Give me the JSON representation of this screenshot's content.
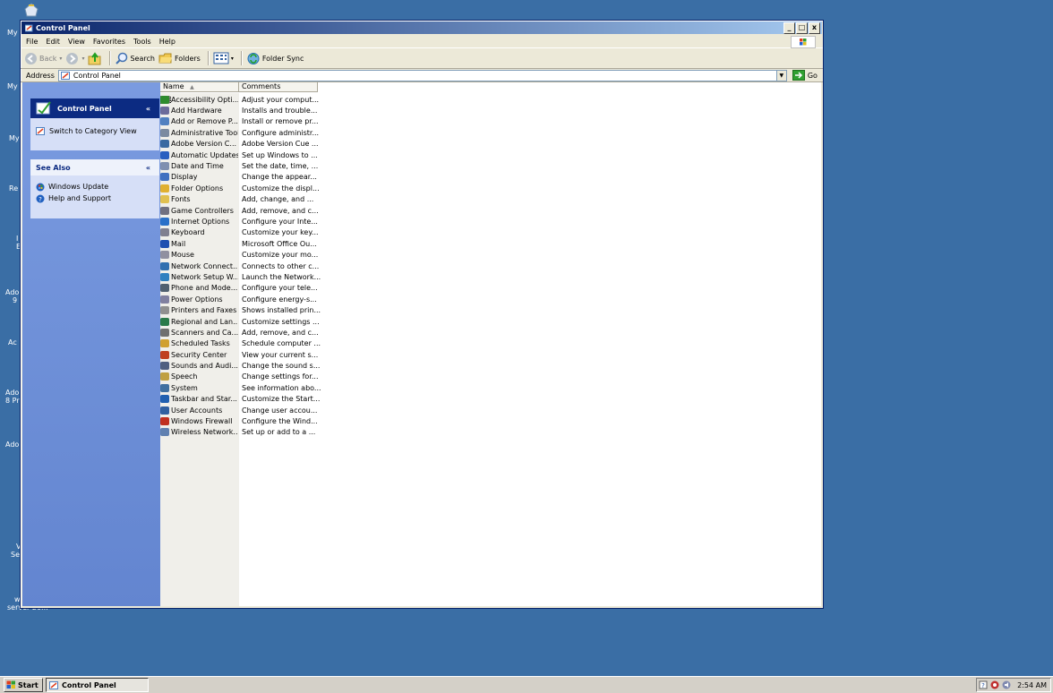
{
  "desktop": {
    "fragments": [
      "My",
      "My",
      "My",
      "Re",
      "I",
      "E",
      "Ado",
      "9",
      "Ac",
      "Ado",
      "8 Pr",
      "Ado",
      "V",
      "Se",
      "w",
      "server 20..."
    ]
  },
  "window": {
    "title": "Control Panel",
    "buttons": {
      "minimize": "_",
      "maximize": "□",
      "close": "x"
    },
    "menu": [
      "File",
      "Edit",
      "View",
      "Favorites",
      "Tools",
      "Help"
    ],
    "toolbar": {
      "back": "Back",
      "search": "Search",
      "folders": "Folders",
      "folder_sync": "Folder Sync"
    },
    "address": {
      "label": "Address",
      "value": "Control Panel",
      "go": "Go"
    }
  },
  "taskpane": {
    "panel1": {
      "title": "Control Panel",
      "items": [
        "Switch to Category View"
      ]
    },
    "panel2": {
      "title": "See Also",
      "items": [
        "Windows Update",
        "Help and Support"
      ]
    }
  },
  "list": {
    "columns": [
      "Name",
      "Comments"
    ],
    "items": [
      {
        "name": "Accessibility Opti...",
        "comment": "Adjust your comput...",
        "color": "#2e8b2e"
      },
      {
        "name": "Add Hardware",
        "comment": "Installs and trouble...",
        "color": "#6b6b9a"
      },
      {
        "name": "Add or Remove P...",
        "comment": "Install or remove pr...",
        "color": "#5080c0"
      },
      {
        "name": "Administrative Tools",
        "comment": "Configure administr...",
        "color": "#7a8aa0"
      },
      {
        "name": "Adobe Version C...",
        "comment": "Adobe Version Cue ...",
        "color": "#3a6aa0"
      },
      {
        "name": "Automatic Updates",
        "comment": "Set up Windows to ...",
        "color": "#2a60c0"
      },
      {
        "name": "Date and Time",
        "comment": "Set the date, time, ...",
        "color": "#8090b0"
      },
      {
        "name": "Display",
        "comment": "Change the appear...",
        "color": "#4070c0"
      },
      {
        "name": "Folder Options",
        "comment": "Customize the displ...",
        "color": "#e0b030"
      },
      {
        "name": "Fonts",
        "comment": "Add, change, and ...",
        "color": "#e0c050"
      },
      {
        "name": "Game Controllers",
        "comment": "Add, remove, and c...",
        "color": "#707080"
      },
      {
        "name": "Internet Options",
        "comment": "Configure your Inte...",
        "color": "#2a70c8"
      },
      {
        "name": "Keyboard",
        "comment": "Customize your key...",
        "color": "#808090"
      },
      {
        "name": "Mail",
        "comment": "Microsoft Office Ou...",
        "color": "#2050b0"
      },
      {
        "name": "Mouse",
        "comment": "Customize your mo...",
        "color": "#9090a0"
      },
      {
        "name": "Network Connect...",
        "comment": "Connects to other c...",
        "color": "#3070b0"
      },
      {
        "name": "Network Setup W...",
        "comment": "Launch the Network...",
        "color": "#3080c0"
      },
      {
        "name": "Phone and Mode...",
        "comment": "Configure your tele...",
        "color": "#506070"
      },
      {
        "name": "Power Options",
        "comment": "Configure energy-s...",
        "color": "#8080a0"
      },
      {
        "name": "Printers and Faxes",
        "comment": "Shows installed prin...",
        "color": "#909090"
      },
      {
        "name": "Regional and Lan...",
        "comment": "Customize settings ...",
        "color": "#2a7a4a"
      },
      {
        "name": "Scanners and Ca...",
        "comment": "Add, remove, and c...",
        "color": "#707070"
      },
      {
        "name": "Scheduled Tasks",
        "comment": "Schedule computer ...",
        "color": "#d0a030"
      },
      {
        "name": "Security Center",
        "comment": "View your current s...",
        "color": "#c04020"
      },
      {
        "name": "Sounds and Audi...",
        "comment": "Change the sound s...",
        "color": "#506080"
      },
      {
        "name": "Speech",
        "comment": "Change settings for...",
        "color": "#c0a040"
      },
      {
        "name": "System",
        "comment": "See information abo...",
        "color": "#4070a0"
      },
      {
        "name": "Taskbar and Star...",
        "comment": "Customize the Start...",
        "color": "#2060b0"
      },
      {
        "name": "User Accounts",
        "comment": "Change user accou...",
        "color": "#3060a0"
      },
      {
        "name": "Windows Firewall",
        "comment": "Configure the Wind...",
        "color": "#c03020"
      },
      {
        "name": "Wireless Network...",
        "comment": "Set up or add to a ...",
        "color": "#6080b0"
      }
    ]
  },
  "taskbar": {
    "start": "Start",
    "active_task": "Control Panel",
    "clock": "2:54 AM"
  }
}
